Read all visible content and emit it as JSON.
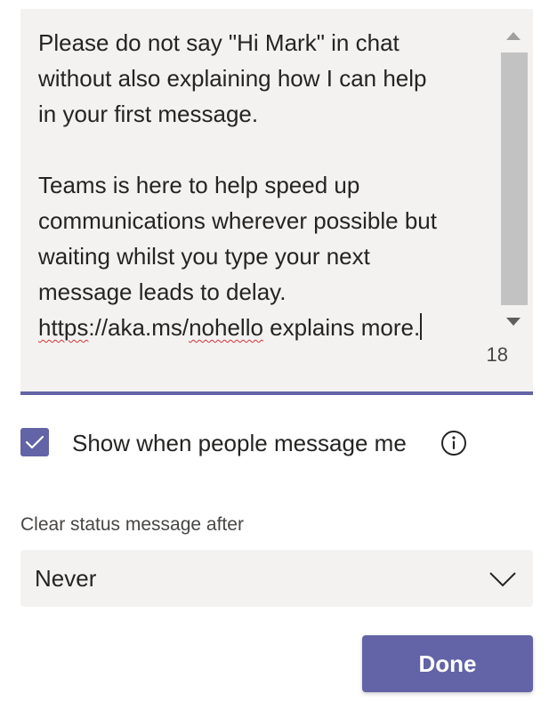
{
  "status_message": {
    "line1": "Please do not say \"Hi Mark\" in chat",
    "line2": "without also explaining how I can help",
    "line3": "in your first message.",
    "line4": "Teams is here to help speed up",
    "line5": "communications wherever possible but",
    "line6": "waiting whilst you type your next",
    "line7": "message leads to delay.",
    "line8_link_part1": "https",
    "line8_link_part2": "://aka.ms/",
    "line8_link_part3": "nohello",
    "line8_rest": " explains more.",
    "char_count": "18"
  },
  "show_when_messaged": {
    "checked": true,
    "label": "Show when people message me"
  },
  "clear_status": {
    "label": "Clear status message after",
    "selected": "Never"
  },
  "done_label": "Done",
  "colors": {
    "accent": "#6264a7",
    "field_bg": "#f3f2f1",
    "text": "#252423",
    "spell_error": "#d13438"
  },
  "icons": {
    "checkbox": "checkmark-icon",
    "info": "info-icon",
    "dropdown": "chevron-down-icon",
    "scroll_up": "scroll-up-arrow-icon",
    "scroll_down": "scroll-down-arrow-icon"
  }
}
